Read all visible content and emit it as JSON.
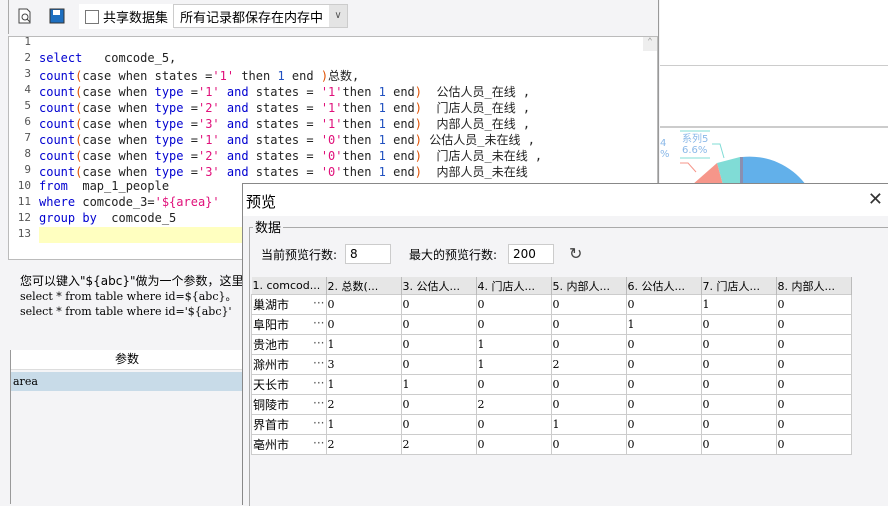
{
  "toolbar": {
    "share_label": "共享数据集",
    "mode_select": "所有记录都保存在内存中"
  },
  "editor": {
    "lines": [
      "",
      "select   comcode_5,",
      "count(case when states ='1' then 1 end )总数,",
      "count(case when type ='1' and states = '1'then 1 end)  公估人员_在线 ,",
      "count(case when type ='2' and states = '1'then 1 end)  门店人员_在线 ,",
      "count(case when type ='3' and states = '1'then 1 end)  内部人员_在线 ,",
      "count(case when type ='1' and states = '0'then 1 end) 公估人员_未在线 ,",
      "count(case when type ='2' and states = '0'then 1 end)  门店人员_未在线 ,",
      "count(case when type ='3' and states = '0'then 1 end)  内部人员_未在线",
      "from  map_1_people",
      "where comcode_3='${area}'",
      "group by  comcode_5",
      ""
    ]
  },
  "hint": {
    "line1": "您可以键入\"${abc}\"做为一个参数，这里a",
    "line2": "select * from table where id=${abc}。",
    "line3": "select * from table where id='${abc}'"
  },
  "params": {
    "header": "参数",
    "rows": [
      "area"
    ]
  },
  "chart": {
    "label_name": "系列5",
    "label_value": "6.6%",
    "partial_label": "4",
    "partial_pct": "%"
  },
  "dialog": {
    "title": "预览",
    "group_label": "数据",
    "current_rows_label": "当前预览行数:",
    "current_rows": "8",
    "max_rows_label": "最大的预览行数:",
    "max_rows": "200",
    "columns": [
      "1. comcod...",
      "2. 总数(...",
      "3. 公估人...",
      "4. 门店人...",
      "5. 内部人...",
      "6. 公估人...",
      "7. 门店人...",
      "8. 内部人..."
    ],
    "rows": [
      [
        "巢湖市",
        "0",
        "0",
        "0",
        "0",
        "0",
        "1",
        "0"
      ],
      [
        "阜阳市",
        "0",
        "0",
        "0",
        "0",
        "1",
        "0",
        "0"
      ],
      [
        "贵池市",
        "1",
        "0",
        "1",
        "0",
        "0",
        "0",
        "0"
      ],
      [
        "滁州市",
        "3",
        "0",
        "1",
        "2",
        "0",
        "0",
        "0"
      ],
      [
        "天长市",
        "1",
        "1",
        "0",
        "0",
        "0",
        "0",
        "0"
      ],
      [
        "铜陵市",
        "2",
        "0",
        "2",
        "0",
        "0",
        "0",
        "0"
      ],
      [
        "界首市",
        "1",
        "0",
        "0",
        "1",
        "0",
        "0",
        "0"
      ],
      [
        "亳州市",
        "2",
        "2",
        "0",
        "0",
        "0",
        "0",
        "0"
      ]
    ]
  }
}
